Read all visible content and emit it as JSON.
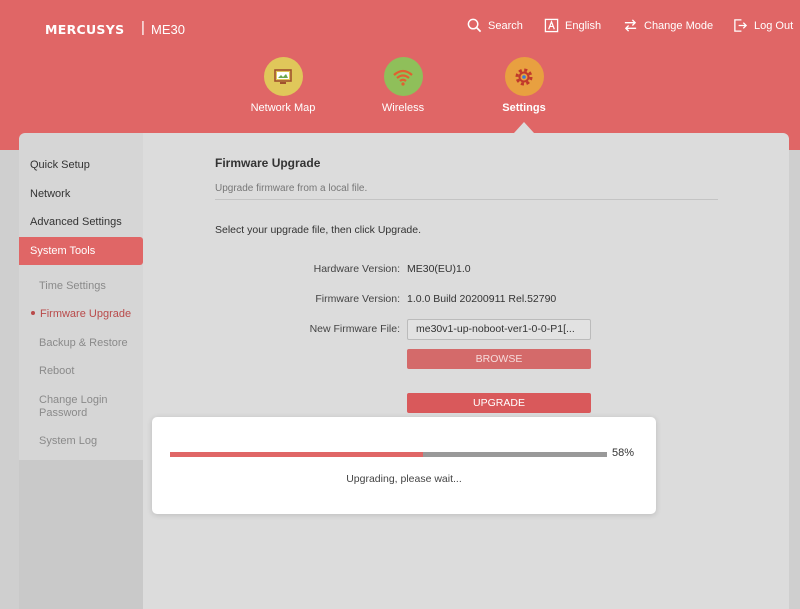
{
  "header": {
    "brand": "MERCUSYS",
    "separator": "|",
    "model": "ME30",
    "links": {
      "search": "Search",
      "language": "English",
      "change_mode": "Change Mode",
      "logout": "Log Out"
    },
    "nav": [
      {
        "label": "Network Map",
        "icon": "network-map-icon"
      },
      {
        "label": "Wireless",
        "icon": "wifi-icon"
      },
      {
        "label": "Settings",
        "icon": "gear-icon",
        "active": true
      }
    ]
  },
  "sidebar": {
    "items": [
      "Quick Setup",
      "Network",
      "Advanced Settings",
      "System Tools"
    ],
    "active": "System Tools",
    "sub_items": [
      "Time Settings",
      "Firmware Upgrade",
      "Backup & Restore",
      "Reboot",
      "Change Login Password",
      "System Log"
    ],
    "current_sub": "Firmware Upgrade"
  },
  "main": {
    "title": "Firmware Upgrade",
    "subtitle": "Upgrade firmware from a local file.",
    "instruction": "Select your upgrade file, then click Upgrade.",
    "hardware_label": "Hardware Version:",
    "hardware_value": "ME30(EU)1.0",
    "firmware_label": "Firmware Version:",
    "firmware_value": "1.0.0 Build 20200911 Rel.52790",
    "file_label": "New Firmware File:",
    "file_value": "me30v1-up-noboot-ver1-0-0-P1[...",
    "browse_label": "BROWSE",
    "upgrade_label": "UPGRADE"
  },
  "progress": {
    "percent": 58,
    "percent_text": "58%",
    "message": "Upgrading, please wait..."
  },
  "colors": {
    "brand": "#e06666",
    "button": "#d9595b",
    "nav_icon_bg": "#e0c75a",
    "wifi_icon_bg": "#8fbf5a",
    "gear_icon_bg": "#e8a040"
  }
}
